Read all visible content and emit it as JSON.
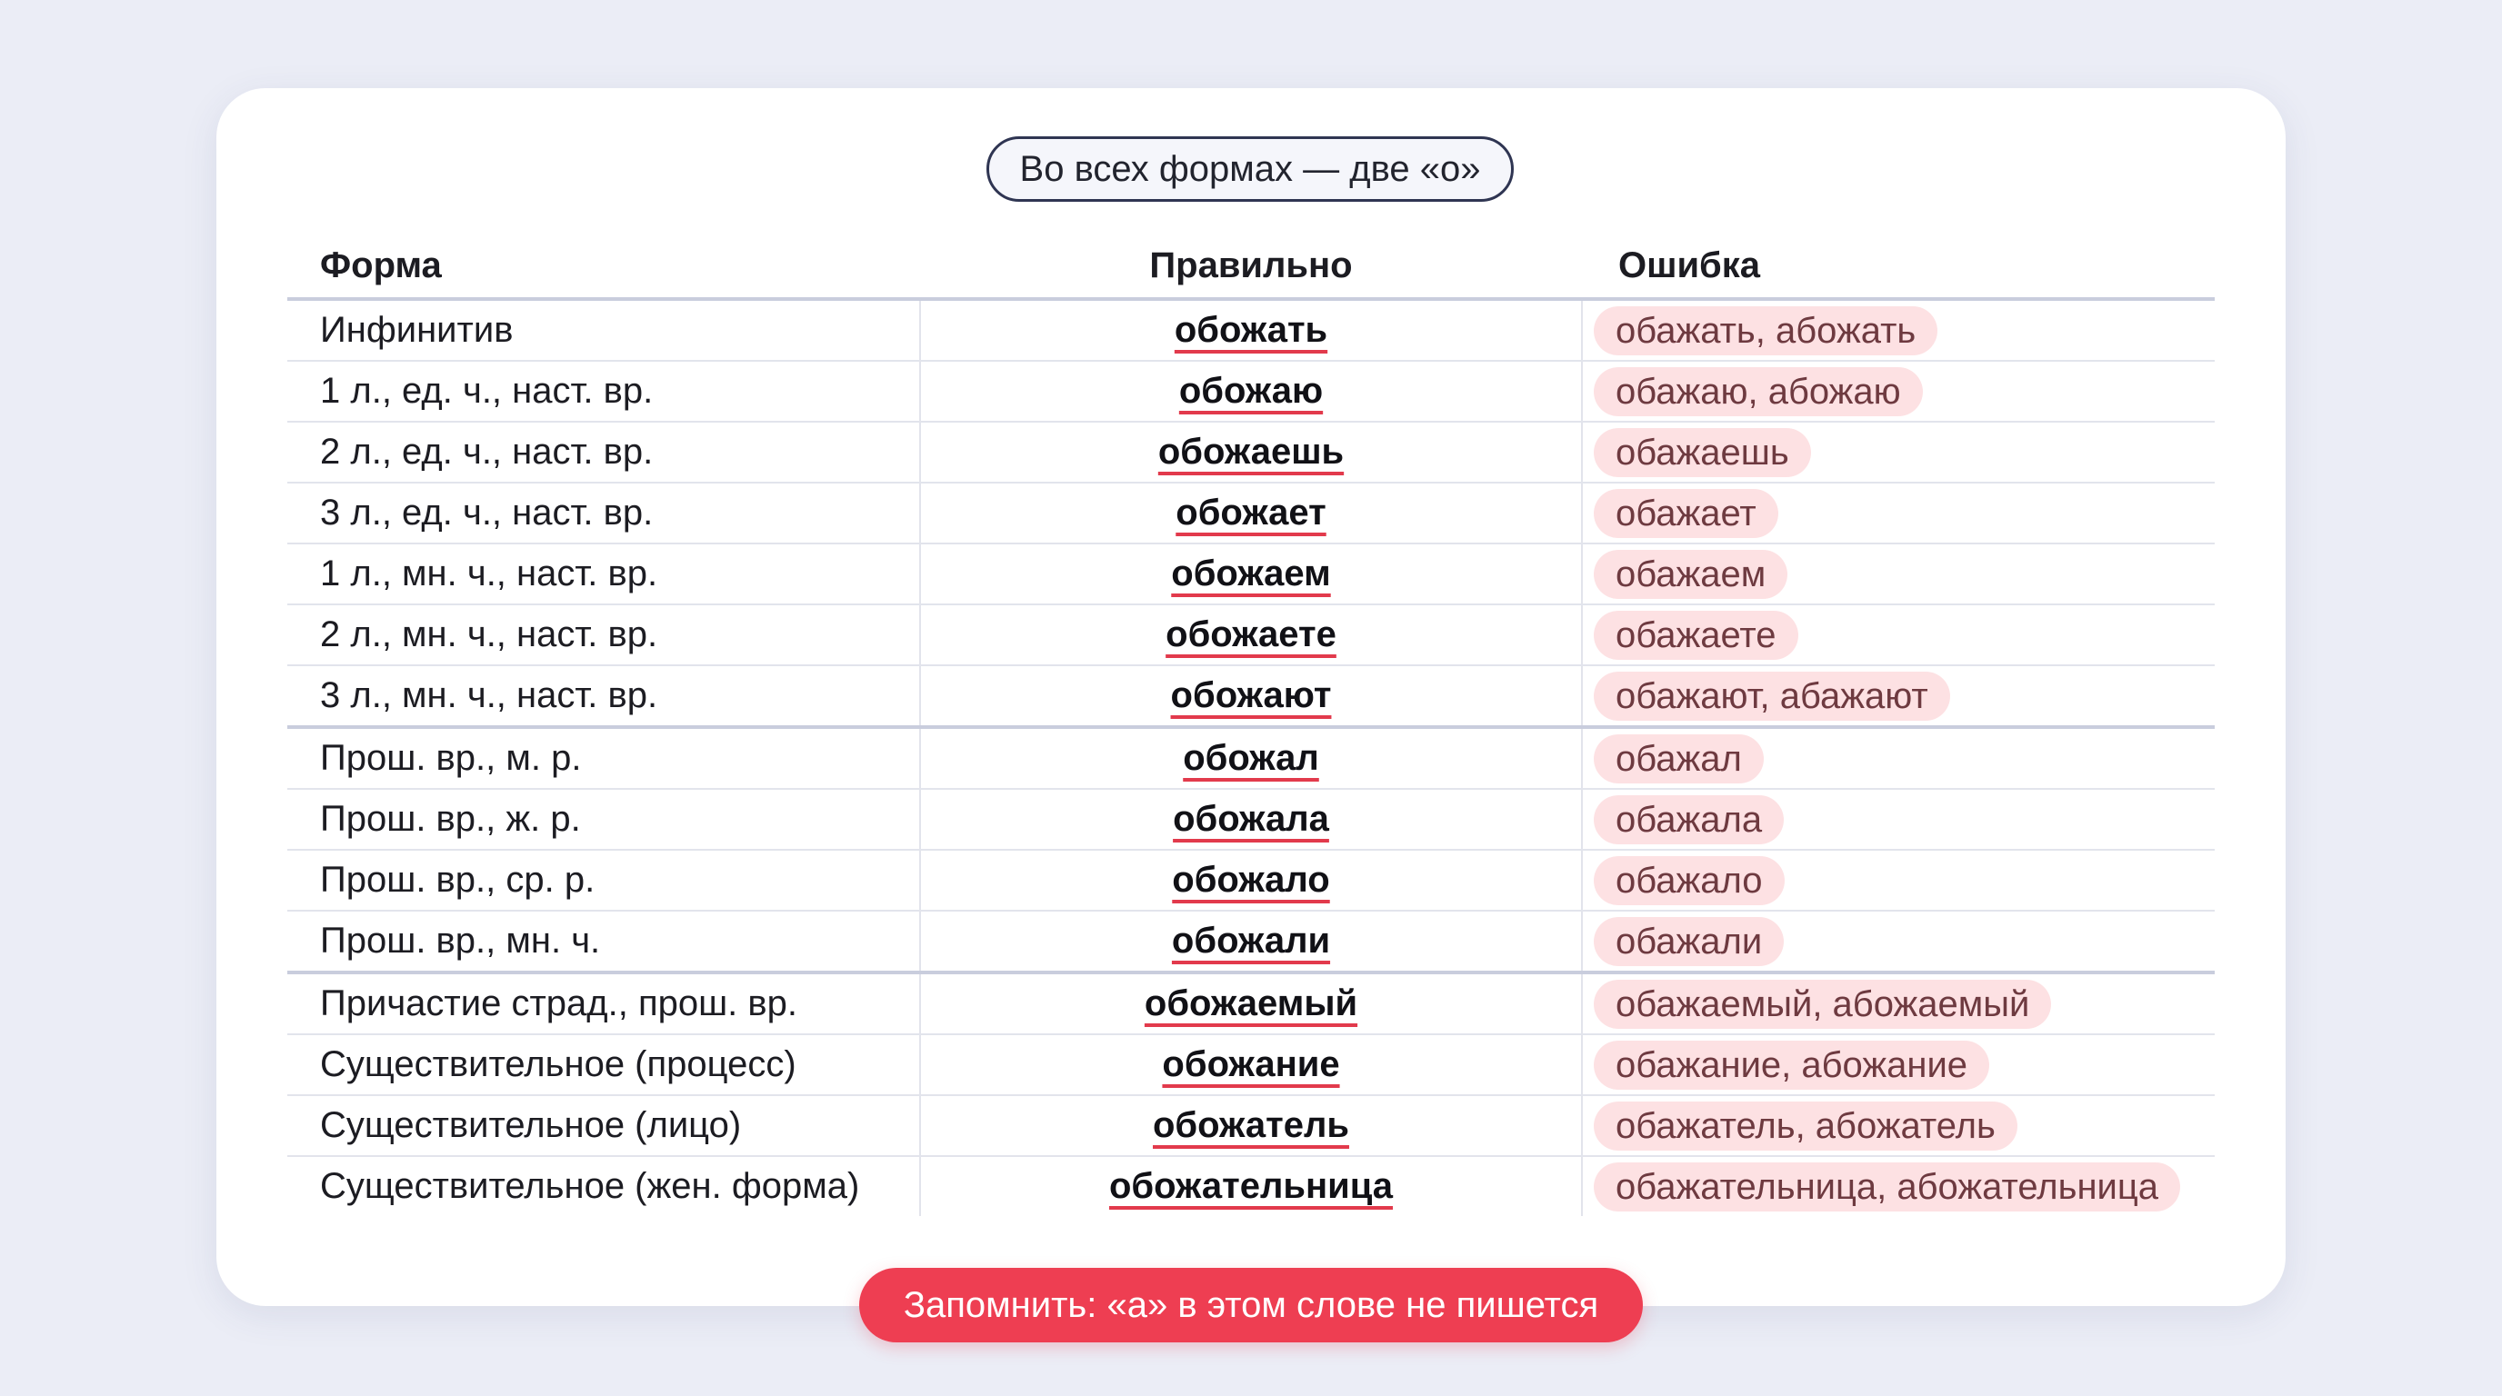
{
  "header_pill": "Во всех формах — две «о»",
  "columns": {
    "form": "Форма",
    "correct": "Правильно",
    "error": "Ошибка"
  },
  "rows": [
    {
      "form": "Инфинитив",
      "correct": "обожать",
      "error": "обажать, абожать"
    },
    {
      "form": "1 л., ед. ч., наст. вр.",
      "correct": "обожаю",
      "error": "обажаю, абожаю"
    },
    {
      "form": "2 л., ед. ч., наст. вр.",
      "correct": "обожаешь",
      "error": "обажаешь"
    },
    {
      "form": "3 л., ед. ч., наст. вр.",
      "correct": "обожает",
      "error": "обажает"
    },
    {
      "form": "1 л., мн. ч., наст. вр.",
      "correct": "обожаем",
      "error": "обажаем"
    },
    {
      "form": "2 л., мн. ч., наст. вр.",
      "correct": "обожаете",
      "error": "обажаете"
    },
    {
      "form": "3 л., мн. ч., наст. вр.",
      "correct": "обожают",
      "error": "обажают, абажают"
    },
    {
      "form": "Прош. вр., м. р.",
      "correct": "обожал",
      "error": "обажал"
    },
    {
      "form": "Прош. вр., ж. р.",
      "correct": "обожала",
      "error": "обажала"
    },
    {
      "form": "Прош. вр., ср. р.",
      "correct": "обожало",
      "error": "обажало"
    },
    {
      "form": "Прош. вр., мн. ч.",
      "correct": "обожали",
      "error": "обажали"
    },
    {
      "form": "Причастие страд., прош. вр.",
      "correct": "обожаемый",
      "error": "обажаемый, абожаемый"
    },
    {
      "form": "Существительное (процесс)",
      "correct": "обожание",
      "error": "обажание, абожание"
    },
    {
      "form": "Существительное (лицо)",
      "correct": "обожатель",
      "error": "обажатель, абожатель"
    },
    {
      "form": "Существительное (жен. форма)",
      "correct": "обожательница",
      "error": "обажательница, абожательница"
    }
  ],
  "note": "Запомнить: «а» в этом слове не пишется",
  "colors": {
    "background": "#ebedf6",
    "card": "#ffffff",
    "accent": "#ee3e52",
    "error_highlight": "#fde1e3",
    "underline": "#e23a4c"
  }
}
